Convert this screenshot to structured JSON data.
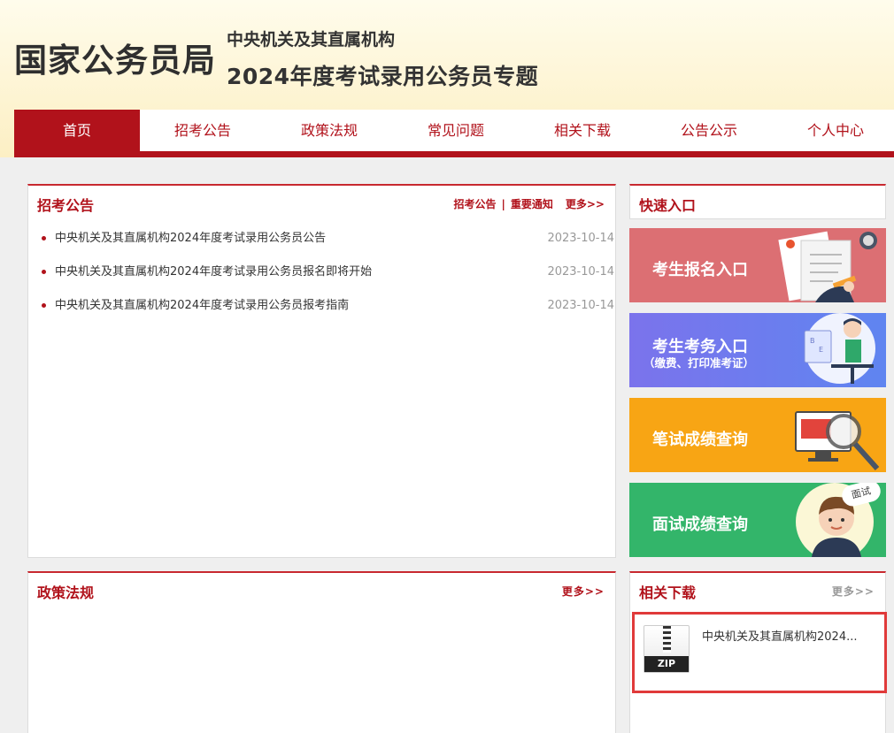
{
  "header": {
    "logo": "国家公务员局",
    "title_line1": "中央机关及其直属机构",
    "title_line2": "2024年度考试录用公务员专题"
  },
  "nav": {
    "items": [
      {
        "label": "首页",
        "active": true
      },
      {
        "label": "招考公告"
      },
      {
        "label": "政策法规"
      },
      {
        "label": "常见问题"
      },
      {
        "label": "相关下载"
      },
      {
        "label": "公告公示"
      },
      {
        "label": "个人中心"
      }
    ]
  },
  "announcements": {
    "title": "招考公告",
    "link1": "招考公告",
    "separator": "|",
    "link2": "重要通知",
    "more": "更多>>",
    "items": [
      {
        "title": "中央机关及其直属机构2024年度考试录用公务员公告",
        "date": "2023-10-14"
      },
      {
        "title": "中央机关及其直属机构2024年度考试录用公务员报名即将开始",
        "date": "2023-10-14"
      },
      {
        "title": "中央机关及其直属机构2024年度考试录用公务员报考指南",
        "date": "2023-10-14"
      }
    ]
  },
  "quick": {
    "title": "快速入口",
    "entries": [
      {
        "label": "考生报名入口",
        "color": "#dc6f73"
      },
      {
        "label": "考生考务入口",
        "sub": "（缴费、打印准考证）",
        "color": "#7b74ec"
      },
      {
        "label": "笔试成绩查询",
        "color": "#f8a514"
      },
      {
        "label": "面试成绩查询",
        "badge": "面试",
        "color": "#33b56a"
      }
    ]
  },
  "policy": {
    "title": "政策法规",
    "more": "更多>>"
  },
  "downloads": {
    "title": "相关下载",
    "more": "更多>>",
    "file_label": "ZIP",
    "file_title": "中央机关及其直属机构2024..."
  },
  "colors": {
    "brand_red": "#b1121b",
    "highlight_border": "#e03a3a"
  }
}
